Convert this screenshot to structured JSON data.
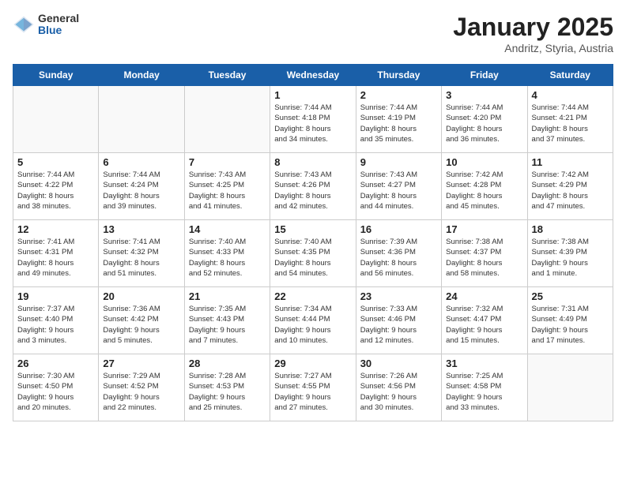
{
  "header": {
    "logo_general": "General",
    "logo_blue": "Blue",
    "title": "January 2025",
    "subtitle": "Andritz, Styria, Austria"
  },
  "days_of_week": [
    "Sunday",
    "Monday",
    "Tuesday",
    "Wednesday",
    "Thursday",
    "Friday",
    "Saturday"
  ],
  "weeks": [
    [
      {
        "day": "",
        "info": ""
      },
      {
        "day": "",
        "info": ""
      },
      {
        "day": "",
        "info": ""
      },
      {
        "day": "1",
        "info": "Sunrise: 7:44 AM\nSunset: 4:18 PM\nDaylight: 8 hours\nand 34 minutes."
      },
      {
        "day": "2",
        "info": "Sunrise: 7:44 AM\nSunset: 4:19 PM\nDaylight: 8 hours\nand 35 minutes."
      },
      {
        "day": "3",
        "info": "Sunrise: 7:44 AM\nSunset: 4:20 PM\nDaylight: 8 hours\nand 36 minutes."
      },
      {
        "day": "4",
        "info": "Sunrise: 7:44 AM\nSunset: 4:21 PM\nDaylight: 8 hours\nand 37 minutes."
      }
    ],
    [
      {
        "day": "5",
        "info": "Sunrise: 7:44 AM\nSunset: 4:22 PM\nDaylight: 8 hours\nand 38 minutes."
      },
      {
        "day": "6",
        "info": "Sunrise: 7:44 AM\nSunset: 4:24 PM\nDaylight: 8 hours\nand 39 minutes."
      },
      {
        "day": "7",
        "info": "Sunrise: 7:43 AM\nSunset: 4:25 PM\nDaylight: 8 hours\nand 41 minutes."
      },
      {
        "day": "8",
        "info": "Sunrise: 7:43 AM\nSunset: 4:26 PM\nDaylight: 8 hours\nand 42 minutes."
      },
      {
        "day": "9",
        "info": "Sunrise: 7:43 AM\nSunset: 4:27 PM\nDaylight: 8 hours\nand 44 minutes."
      },
      {
        "day": "10",
        "info": "Sunrise: 7:42 AM\nSunset: 4:28 PM\nDaylight: 8 hours\nand 45 minutes."
      },
      {
        "day": "11",
        "info": "Sunrise: 7:42 AM\nSunset: 4:29 PM\nDaylight: 8 hours\nand 47 minutes."
      }
    ],
    [
      {
        "day": "12",
        "info": "Sunrise: 7:41 AM\nSunset: 4:31 PM\nDaylight: 8 hours\nand 49 minutes."
      },
      {
        "day": "13",
        "info": "Sunrise: 7:41 AM\nSunset: 4:32 PM\nDaylight: 8 hours\nand 51 minutes."
      },
      {
        "day": "14",
        "info": "Sunrise: 7:40 AM\nSunset: 4:33 PM\nDaylight: 8 hours\nand 52 minutes."
      },
      {
        "day": "15",
        "info": "Sunrise: 7:40 AM\nSunset: 4:35 PM\nDaylight: 8 hours\nand 54 minutes."
      },
      {
        "day": "16",
        "info": "Sunrise: 7:39 AM\nSunset: 4:36 PM\nDaylight: 8 hours\nand 56 minutes."
      },
      {
        "day": "17",
        "info": "Sunrise: 7:38 AM\nSunset: 4:37 PM\nDaylight: 8 hours\nand 58 minutes."
      },
      {
        "day": "18",
        "info": "Sunrise: 7:38 AM\nSunset: 4:39 PM\nDaylight: 9 hours\nand 1 minute."
      }
    ],
    [
      {
        "day": "19",
        "info": "Sunrise: 7:37 AM\nSunset: 4:40 PM\nDaylight: 9 hours\nand 3 minutes."
      },
      {
        "day": "20",
        "info": "Sunrise: 7:36 AM\nSunset: 4:42 PM\nDaylight: 9 hours\nand 5 minutes."
      },
      {
        "day": "21",
        "info": "Sunrise: 7:35 AM\nSunset: 4:43 PM\nDaylight: 9 hours\nand 7 minutes."
      },
      {
        "day": "22",
        "info": "Sunrise: 7:34 AM\nSunset: 4:44 PM\nDaylight: 9 hours\nand 10 minutes."
      },
      {
        "day": "23",
        "info": "Sunrise: 7:33 AM\nSunset: 4:46 PM\nDaylight: 9 hours\nand 12 minutes."
      },
      {
        "day": "24",
        "info": "Sunrise: 7:32 AM\nSunset: 4:47 PM\nDaylight: 9 hours\nand 15 minutes."
      },
      {
        "day": "25",
        "info": "Sunrise: 7:31 AM\nSunset: 4:49 PM\nDaylight: 9 hours\nand 17 minutes."
      }
    ],
    [
      {
        "day": "26",
        "info": "Sunrise: 7:30 AM\nSunset: 4:50 PM\nDaylight: 9 hours\nand 20 minutes."
      },
      {
        "day": "27",
        "info": "Sunrise: 7:29 AM\nSunset: 4:52 PM\nDaylight: 9 hours\nand 22 minutes."
      },
      {
        "day": "28",
        "info": "Sunrise: 7:28 AM\nSunset: 4:53 PM\nDaylight: 9 hours\nand 25 minutes."
      },
      {
        "day": "29",
        "info": "Sunrise: 7:27 AM\nSunset: 4:55 PM\nDaylight: 9 hours\nand 27 minutes."
      },
      {
        "day": "30",
        "info": "Sunrise: 7:26 AM\nSunset: 4:56 PM\nDaylight: 9 hours\nand 30 minutes."
      },
      {
        "day": "31",
        "info": "Sunrise: 7:25 AM\nSunset: 4:58 PM\nDaylight: 9 hours\nand 33 minutes."
      },
      {
        "day": "",
        "info": ""
      }
    ]
  ]
}
